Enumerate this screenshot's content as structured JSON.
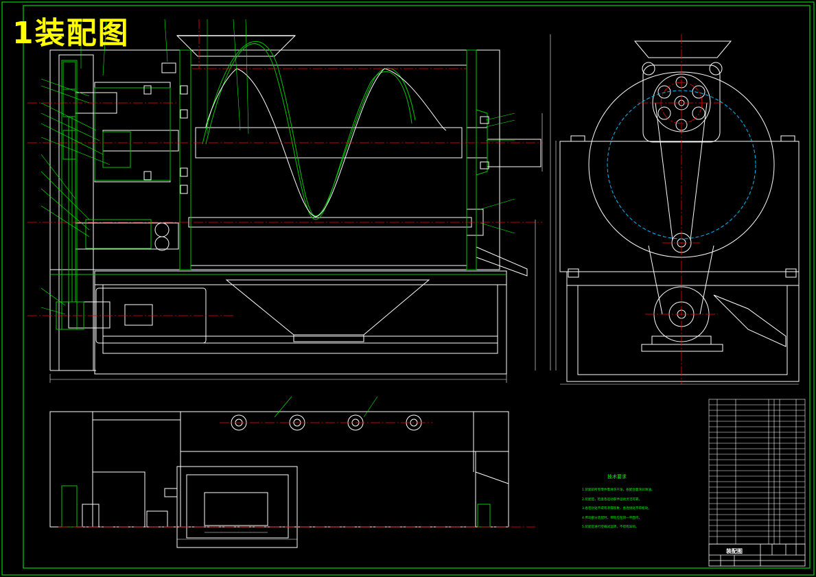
{
  "sheet": {
    "overlay_title": "1装配图",
    "title_block_name": "装配图",
    "colors": {
      "background": "#000000",
      "outline": "#ffffff",
      "frame": "#00ff00",
      "centerline": "#ff0000",
      "hidden": "#00bfff",
      "section": "#00c800",
      "title": "#ffff00"
    }
  },
  "tech_requirements": {
    "title": "技术要求",
    "items": [
      "1.装配前所有零件需清洗干净，各配合面涂润滑油。",
      "2.装配后，检查各运动部件运动灵活可靠。",
      "3.各密封处不得有渗漏现象，各连接处不得松动。",
      "4.传动部分装配时，带轮应在同一平面内，",
      "5.装配后进行空载试运转，不得有异响。"
    ]
  }
}
